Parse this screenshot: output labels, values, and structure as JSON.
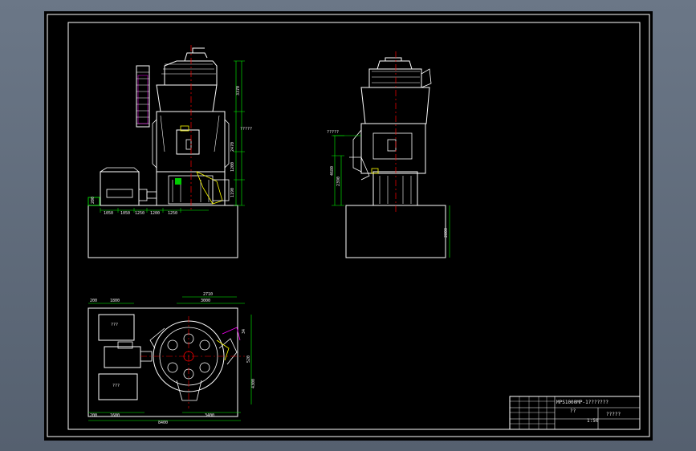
{
  "drawing": {
    "front_view": {
      "dims_horizontal": [
        "1050",
        "1050",
        "1250",
        "1200",
        "1250"
      ],
      "dims_vertical": [
        "3370",
        "2470",
        "1200",
        "1190"
      ],
      "small_labels": [
        "200",
        "?????"
      ]
    },
    "side_view": {
      "top_label": "?????",
      "dims_vertical": [
        "4680",
        "2390",
        "2800"
      ]
    },
    "plan_view": {
      "dims_top": [
        "200",
        "1800",
        "2710",
        "3000"
      ],
      "dims_bottom": [
        "200",
        "1600",
        "8400",
        "3400"
      ],
      "dims_right": [
        "34",
        "520",
        "4300"
      ],
      "box_labels": [
        "???",
        "???"
      ]
    }
  },
  "title_block": {
    "title": "MPS1000MP-1???????",
    "subtitle": "??",
    "unit_label": "?????",
    "scale_label": "1:50"
  },
  "colors": {
    "sheet": "#000000",
    "outline": "#ffffff",
    "dimension": "#00ff00",
    "centerline": "#ff0000",
    "detail": "#ffff00",
    "accent": "#ff00ff"
  }
}
